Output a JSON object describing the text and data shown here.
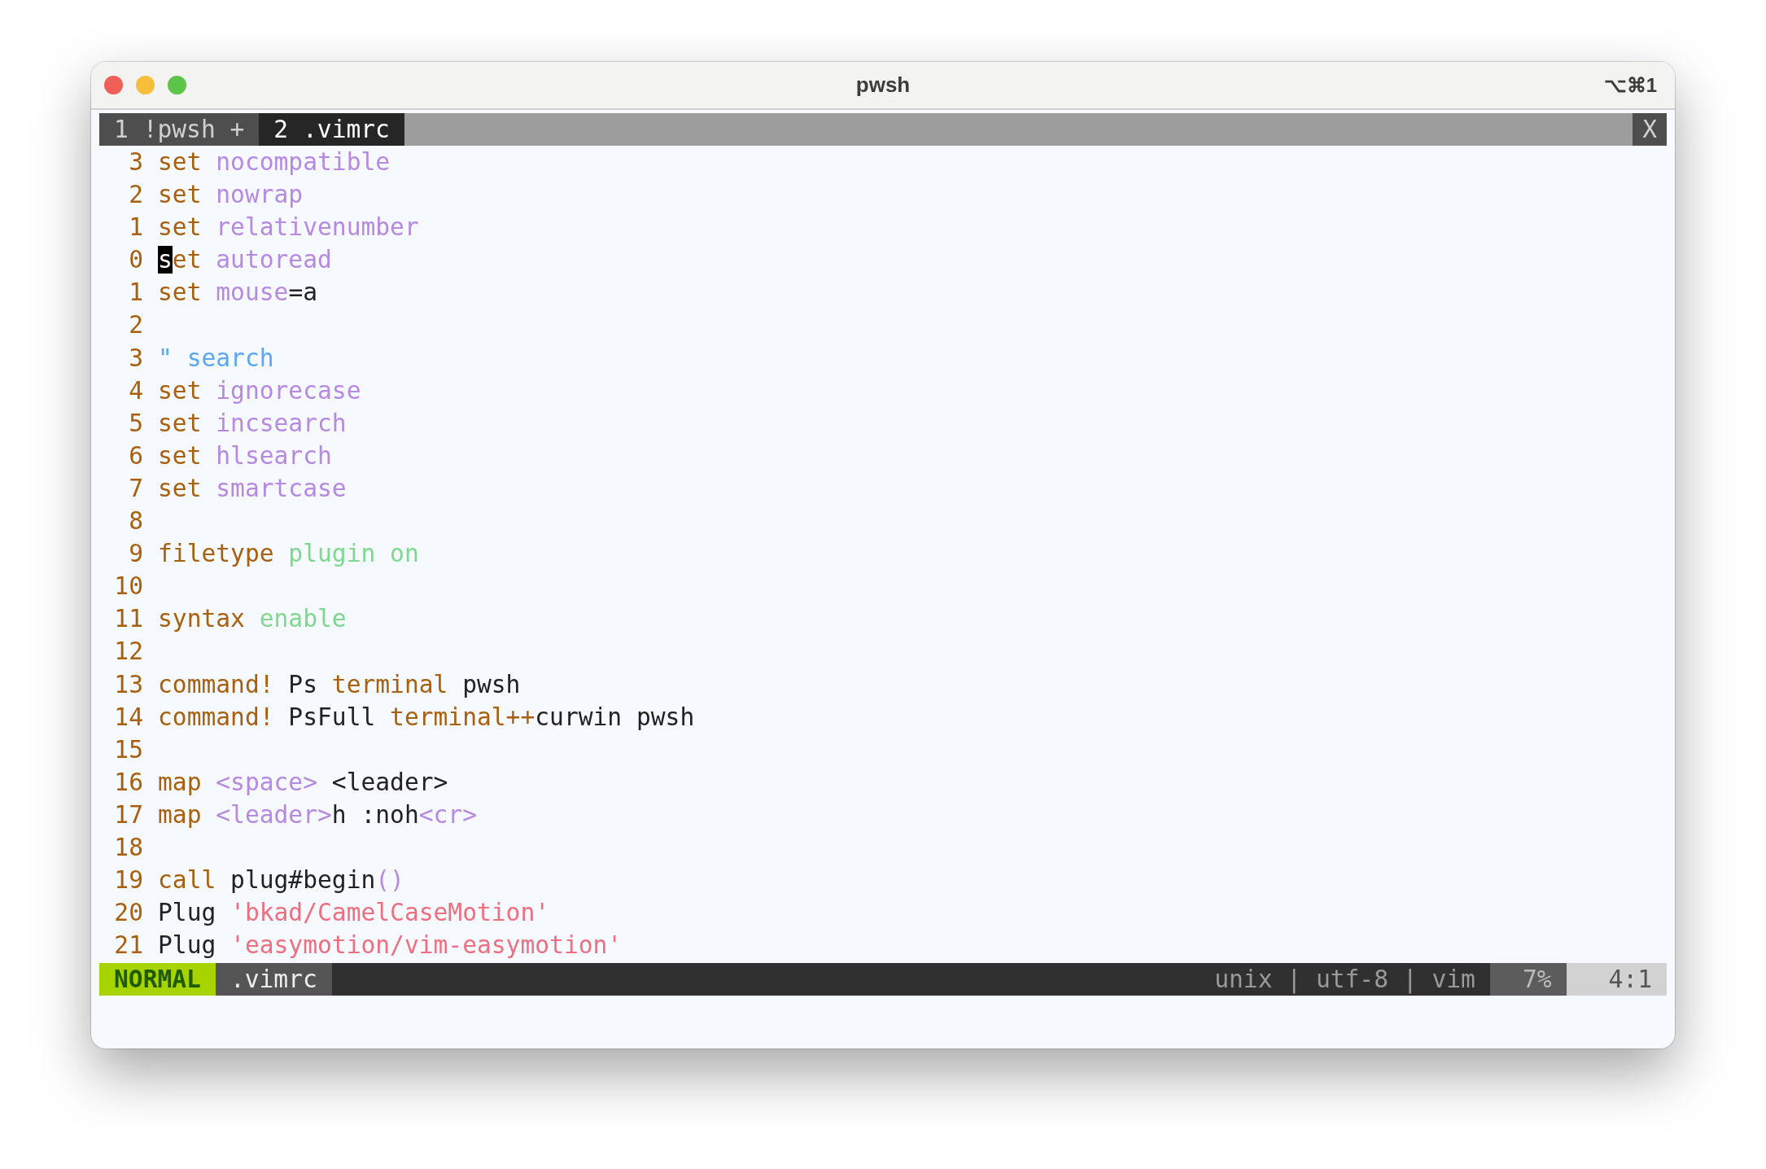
{
  "window": {
    "title": "pwsh",
    "shortcut": "⌥⌘1"
  },
  "tabs": [
    {
      "label": "1 !pwsh +",
      "selected": false
    },
    {
      "label": "2 .vimrc",
      "selected": true
    }
  ],
  "tab_close": "X",
  "lines": [
    {
      "number": "3",
      "tokens": [
        {
          "kind": "keyword",
          "text": "set "
        },
        {
          "kind": "option",
          "text": "nocompatible"
        }
      ]
    },
    {
      "number": "2",
      "tokens": [
        {
          "kind": "keyword",
          "text": "set "
        },
        {
          "kind": "option",
          "text": "nowrap"
        }
      ]
    },
    {
      "number": "1",
      "tokens": [
        {
          "kind": "keyword",
          "text": "set "
        },
        {
          "kind": "option",
          "text": "relativenumber"
        }
      ]
    },
    {
      "number": "0",
      "tokens": [
        {
          "kind": "cursor",
          "text": "s"
        },
        {
          "kind": "keyword",
          "text": "et "
        },
        {
          "kind": "option",
          "text": "autoread"
        }
      ]
    },
    {
      "number": "1",
      "tokens": [
        {
          "kind": "keyword",
          "text": "set "
        },
        {
          "kind": "option",
          "text": "mouse"
        },
        {
          "kind": "plain",
          "text": "=a"
        }
      ]
    },
    {
      "number": "2"
    },
    {
      "number": "3",
      "tokens": [
        {
          "kind": "comment",
          "text": "\" search"
        }
      ]
    },
    {
      "number": "4",
      "tokens": [
        {
          "kind": "keyword",
          "text": "set "
        },
        {
          "kind": "option",
          "text": "ignorecase"
        }
      ]
    },
    {
      "number": "5",
      "tokens": [
        {
          "kind": "keyword",
          "text": "set "
        },
        {
          "kind": "option",
          "text": "incsearch"
        }
      ]
    },
    {
      "number": "6",
      "tokens": [
        {
          "kind": "keyword",
          "text": "set "
        },
        {
          "kind": "option",
          "text": "hlsearch"
        }
      ]
    },
    {
      "number": "7",
      "tokens": [
        {
          "kind": "keyword",
          "text": "set "
        },
        {
          "kind": "option",
          "text": "smartcase"
        }
      ]
    },
    {
      "number": "8"
    },
    {
      "number": "9",
      "tokens": [
        {
          "kind": "keyword",
          "text": "filetype "
        },
        {
          "kind": "value",
          "text": "plugin on"
        }
      ]
    },
    {
      "number": "10"
    },
    {
      "number": "11",
      "tokens": [
        {
          "kind": "keyword",
          "text": "syntax "
        },
        {
          "kind": "value",
          "text": "enable"
        }
      ]
    },
    {
      "number": "12"
    },
    {
      "number": "13",
      "tokens": [
        {
          "kind": "keyword",
          "text": "command! "
        },
        {
          "kind": "plain",
          "text": "Ps "
        },
        {
          "kind": "keyword",
          "text": "terminal "
        },
        {
          "kind": "plain",
          "text": "pwsh"
        }
      ]
    },
    {
      "number": "14",
      "tokens": [
        {
          "kind": "keyword",
          "text": "command! "
        },
        {
          "kind": "plain",
          "text": "PsFull "
        },
        {
          "kind": "keyword",
          "text": "terminal++"
        },
        {
          "kind": "plain",
          "text": "curwin pwsh"
        }
      ]
    },
    {
      "number": "15"
    },
    {
      "number": "16",
      "tokens": [
        {
          "kind": "keyword",
          "text": "map "
        },
        {
          "kind": "option",
          "text": "<space>"
        },
        {
          "kind": "plain",
          "text": " <leader>"
        }
      ]
    },
    {
      "number": "17",
      "tokens": [
        {
          "kind": "keyword",
          "text": "map "
        },
        {
          "kind": "option",
          "text": "<leader>"
        },
        {
          "kind": "plain",
          "text": "h :noh"
        },
        {
          "kind": "option",
          "text": "<cr>"
        }
      ]
    },
    {
      "number": "18"
    },
    {
      "number": "19",
      "tokens": [
        {
          "kind": "keyword",
          "text": "call "
        },
        {
          "kind": "plain",
          "text": "plug#begin"
        },
        {
          "kind": "option",
          "text": "()"
        }
      ]
    },
    {
      "number": "20",
      "tokens": [
        {
          "kind": "plain",
          "text": "Plug "
        },
        {
          "kind": "string",
          "text": "'bkad/CamelCaseMotion'"
        }
      ]
    },
    {
      "number": "21",
      "tokens": [
        {
          "kind": "plain",
          "text": "Plug "
        },
        {
          "kind": "string",
          "text": "'easymotion/vim-easymotion'"
        }
      ]
    }
  ],
  "status_bar": {
    "mode": "NORMAL",
    "file": ".vimrc",
    "info": "unix | utf-8 | vim",
    "percent": "7%",
    "position": "4:1"
  }
}
